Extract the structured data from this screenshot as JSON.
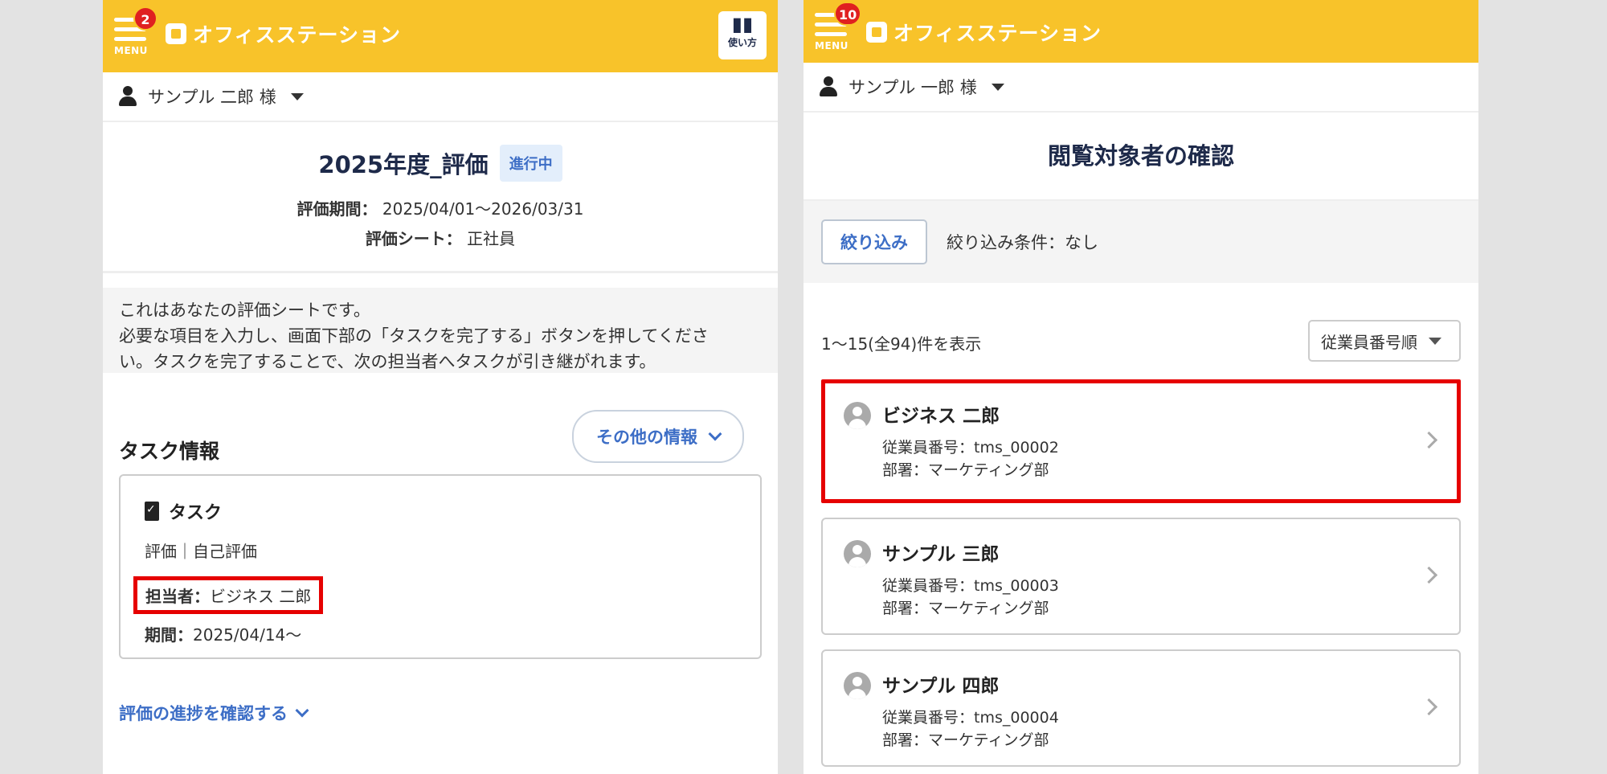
{
  "left": {
    "header": {
      "menu_label": "MENU",
      "badge": "2",
      "logo_text": "オフィスステーション",
      "help_label": "使い方"
    },
    "user": {
      "name": "サンプル 二郎 様"
    },
    "evaluation": {
      "title": "2025年度_評価",
      "status": "進行中",
      "period_label": "評価期間：",
      "period_value": "2025/04/01〜2026/03/31",
      "sheet_label": "評価シート：",
      "sheet_value": "正社員"
    },
    "notice": {
      "line1": "これはあなたの評価シートです。",
      "line2": "必要な項目を入力し、画面下部の「タスクを完了する」ボタンを押してくださ",
      "line3": "い。タスクを完了することで、次の担当者へタスクが引き継がれます。"
    },
    "task_section": {
      "title": "タスク情報",
      "other_button": "その他の情報",
      "card_title": "タスク",
      "category": "評価｜自己評価",
      "assignee_label": "担当者：",
      "assignee_value": "ビジネス 二郎",
      "period_label": "期間：",
      "period_value": "2025/04/14〜"
    },
    "progress_link": "評価の進捗を確認する"
  },
  "right": {
    "header": {
      "menu_label": "MENU",
      "badge": "10",
      "logo_text": "オフィスステーション"
    },
    "user": {
      "name": "サンプル 一郎 様"
    },
    "page_title": "閲覧対象者の確認",
    "filter": {
      "button": "絞り込み",
      "condition": "絞り込み条件：なし"
    },
    "list": {
      "count": "1〜15(全94)件を表示",
      "sort": "従業員番号順"
    },
    "employees": [
      {
        "name": "ビジネス 二郎",
        "id": "従業員番号：tms_00002",
        "dept": "部署：マーケティング部"
      },
      {
        "name": "サンプル 三郎",
        "id": "従業員番号：tms_00003",
        "dept": "部署：マーケティング部"
      },
      {
        "name": "サンプル 四郎",
        "id": "従業員番号：tms_00004",
        "dept": "部署：マーケティング部"
      }
    ]
  },
  "colors": {
    "header_bg": "#f8c32a",
    "accent_blue": "#3d6ec6",
    "highlight_red": "#e60000",
    "badge_red": "#e02020"
  }
}
